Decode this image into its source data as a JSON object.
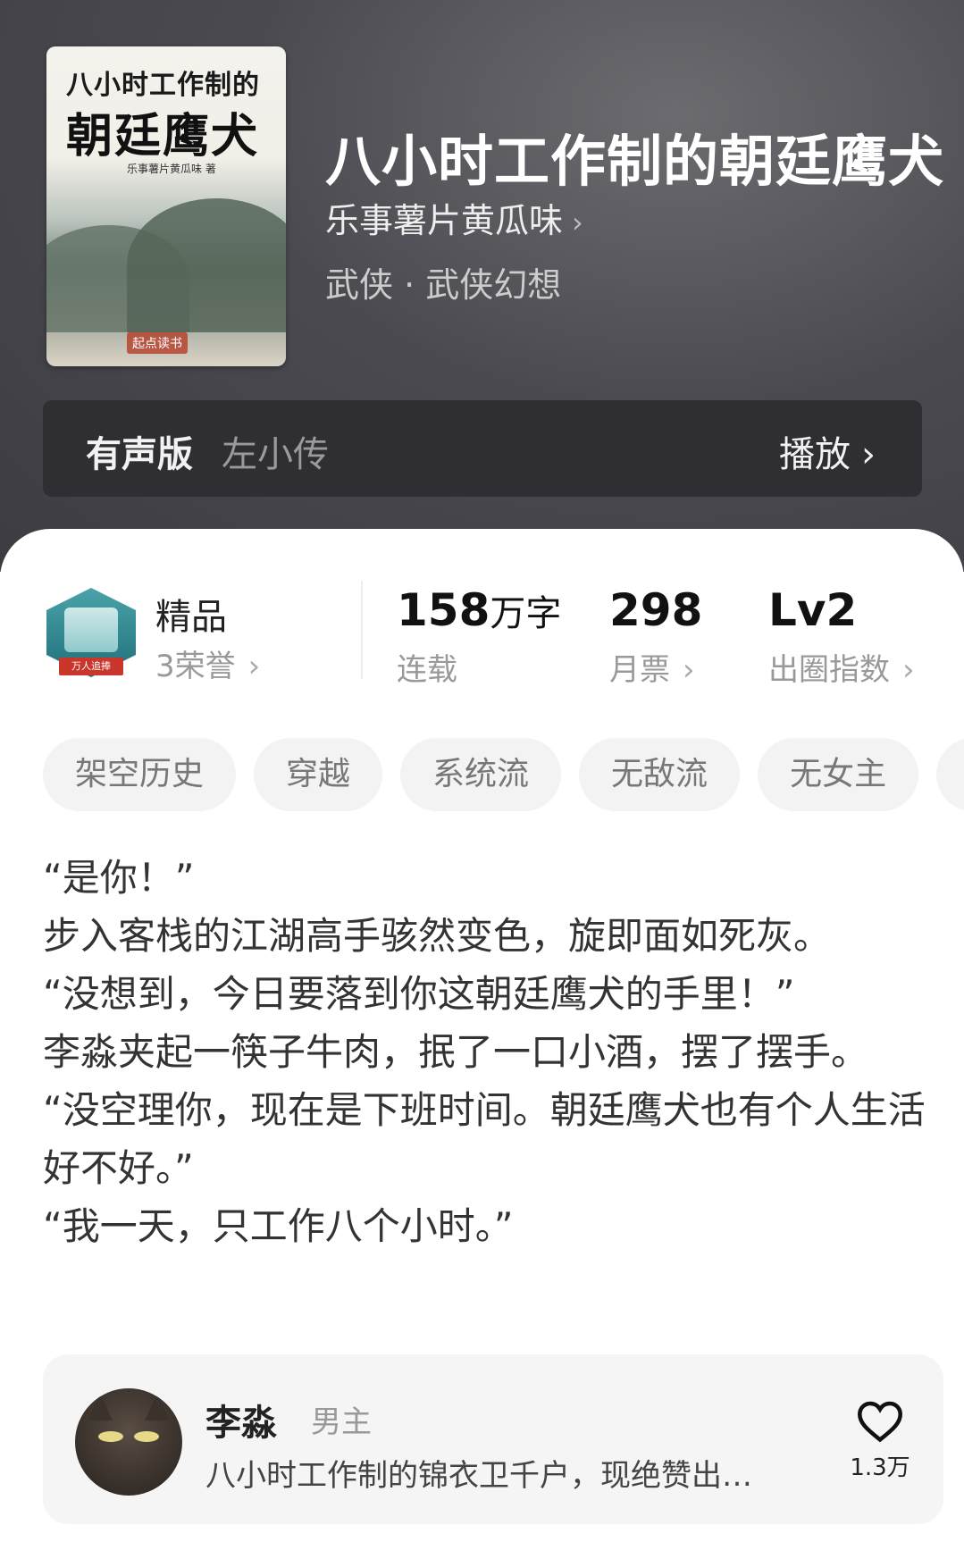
{
  "book": {
    "cover_title_line1": "八小时工作制的",
    "cover_title_line2": "朝廷鹰犬",
    "cover_author": "乐事薯片黄瓜味 著",
    "cover_publisher": "起点读书",
    "title": "八小时工作制的朝廷鹰犬",
    "author": "乐事薯片黄瓜味",
    "genre": "武侠 · 武侠幻想"
  },
  "audio": {
    "label": "有声版",
    "narrator": "左小传",
    "play_label": "播放"
  },
  "quality": {
    "title": "精品",
    "honors": "3荣誉",
    "badge_text": "万人追捧"
  },
  "stats": [
    {
      "value": "158",
      "unit": "万字",
      "label": "连载"
    },
    {
      "value": "298",
      "unit": "",
      "label": "月票"
    },
    {
      "value": "Lv2",
      "unit": "",
      "label": "出圈指数"
    }
  ],
  "tags": [
    "架空历史",
    "穿越",
    "系统流",
    "无敌流",
    "无女主"
  ],
  "excerpt": [
    "“是你！”",
    "步入客栈的江湖高手骇然变色，旋即面如死灰。",
    "“没想到，今日要落到你这朝廷鹰犬的手里！”",
    "李淼夹起一筷子牛肉，抿了一口小酒，摆了摆手。",
    "“没空理你，现在是下班时间。朝廷鹰犬也有个人生活好不好。”",
    "“我一天，只工作八个小时。”"
  ],
  "character": {
    "name": "李淼",
    "role": "男主",
    "description": "八小时工作制的锦衣卫千户，现绝赞出…",
    "likes": "1.3万"
  }
}
